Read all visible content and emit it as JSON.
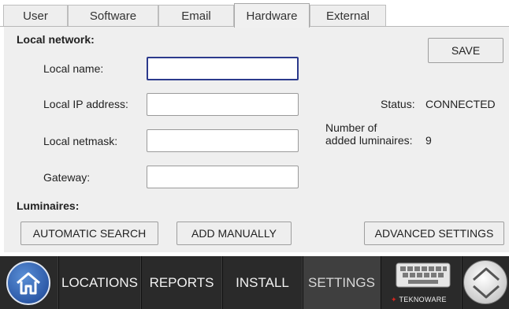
{
  "tabs": [
    {
      "label": "User",
      "active": false
    },
    {
      "label": "Software",
      "active": false
    },
    {
      "label": "Email",
      "active": false
    },
    {
      "label": "Hardware",
      "active": true
    },
    {
      "label": "External",
      "active": false
    }
  ],
  "local_network": {
    "heading": "Local network:",
    "local_name": {
      "label": "Local name:",
      "value": "",
      "placeholder": ""
    },
    "local_ip": {
      "label": "Local IP address:",
      "value": "",
      "placeholder": ""
    },
    "local_netmask": {
      "label": "Local netmask:",
      "value": "",
      "placeholder": ""
    },
    "gateway": {
      "label": "Gateway:",
      "value": "",
      "placeholder": ""
    }
  },
  "save_label": "SAVE",
  "status": {
    "label": "Status:",
    "value": "CONNECTED"
  },
  "luminaires_count": {
    "label_line1": "Number of",
    "label_line2": "added luminaires:",
    "value": "9"
  },
  "luminaires": {
    "heading": "Luminaires:",
    "automatic_search": "AUTOMATIC SEARCH",
    "add_manually": "ADD MANUALLY",
    "advanced_settings": "ADVANCED SETTINGS"
  },
  "nav": {
    "home_icon": "home-icon",
    "items": [
      {
        "label": "LOCATIONS",
        "active": false
      },
      {
        "label": "REPORTS",
        "active": false
      },
      {
        "label": "INSTALL",
        "active": false
      },
      {
        "label": "SETTINGS",
        "active": true
      }
    ],
    "keyboard_icon": "keyboard-icon",
    "brand_text": "TEKNOWARE",
    "brand_mark": "✦",
    "scroll_icon": "up-down-scroll-icon"
  },
  "colors": {
    "focus_border": "#2c3a8c",
    "navbar_bg": "#2a2a2a",
    "home_blue": "#2d5aa8",
    "brand_red": "#d8261e"
  }
}
